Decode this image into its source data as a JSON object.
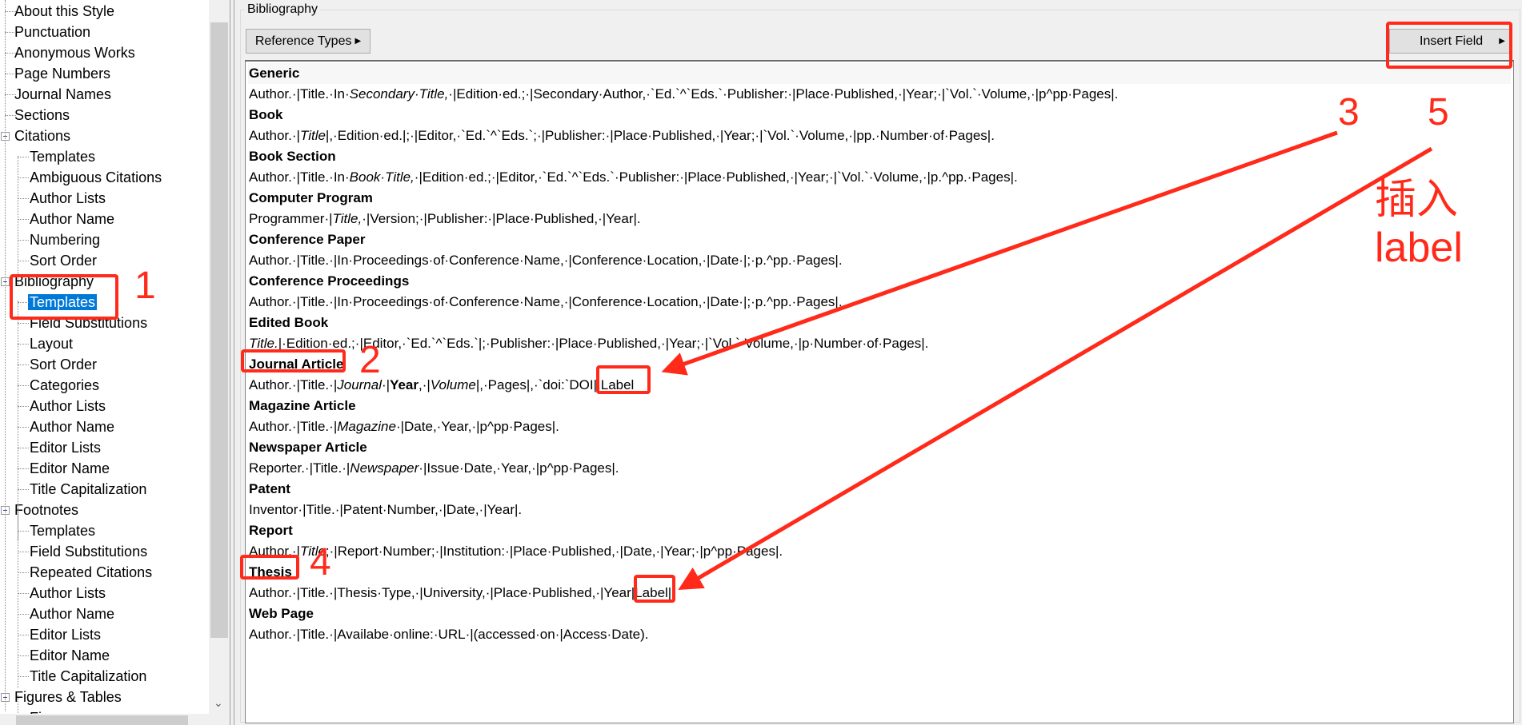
{
  "tree": {
    "items": [
      {
        "label": "About this Style",
        "level": 1
      },
      {
        "label": "Punctuation",
        "level": 1
      },
      {
        "label": "Anonymous Works",
        "level": 1
      },
      {
        "label": "Page Numbers",
        "level": 1
      },
      {
        "label": "Journal Names",
        "level": 1
      },
      {
        "label": "Sections",
        "level": 1
      },
      {
        "label": "Citations",
        "level": 0,
        "expanded": true
      },
      {
        "label": "Templates",
        "level": 2
      },
      {
        "label": "Ambiguous Citations",
        "level": 2
      },
      {
        "label": "Author Lists",
        "level": 2
      },
      {
        "label": "Author Name",
        "level": 2
      },
      {
        "label": "Numbering",
        "level": 2
      },
      {
        "label": "Sort Order",
        "level": 2
      },
      {
        "label": "Bibliography",
        "level": 0,
        "expanded": true
      },
      {
        "label": "Templates",
        "level": 2,
        "selected": true
      },
      {
        "label": "Field Substitutions",
        "level": 2
      },
      {
        "label": "Layout",
        "level": 2
      },
      {
        "label": "Sort Order",
        "level": 2
      },
      {
        "label": "Categories",
        "level": 2
      },
      {
        "label": "Author Lists",
        "level": 2
      },
      {
        "label": "Author Name",
        "level": 2
      },
      {
        "label": "Editor Lists",
        "level": 2
      },
      {
        "label": "Editor Name",
        "level": 2
      },
      {
        "label": "Title Capitalization",
        "level": 2
      },
      {
        "label": "Footnotes",
        "level": 0,
        "expanded": true
      },
      {
        "label": "Templates",
        "level": 2
      },
      {
        "label": "Field Substitutions",
        "level": 2
      },
      {
        "label": "Repeated Citations",
        "level": 2
      },
      {
        "label": "Author Lists",
        "level": 2
      },
      {
        "label": "Author Name",
        "level": 2
      },
      {
        "label": "Editor Lists",
        "level": 2
      },
      {
        "label": "Editor Name",
        "level": 2
      },
      {
        "label": "Title Capitalization",
        "level": 2
      },
      {
        "label": "Figures & Tables",
        "level": 0,
        "expanded": true
      },
      {
        "label": "Fi...",
        "level": 2
      }
    ],
    "selection_color": "#0078d7"
  },
  "panel": {
    "title": "Bibliography",
    "reference_types_label": "Reference Types",
    "insert_field_label": "Insert Field",
    "templates": [
      {
        "type": "Generic",
        "segments": [
          {
            "t": "Author.·|Title.·In·"
          },
          {
            "t": "Secondary·Title,",
            "i": true
          },
          {
            "t": "·|Edition·ed.;·|Secondary·Author,·`Ed.`^`Eds.`·Publisher:·|Place·Published,·|Year;·|`Vol.`·Volume,·|p^pp·Pages|."
          }
        ]
      },
      {
        "type": "Book",
        "segments": [
          {
            "t": "Author.·|"
          },
          {
            "t": "Title",
            "i": true
          },
          {
            "t": "|,·Edition·ed.|;·|Editor,·`Ed.`^`Eds.`;·|Publisher:·|Place·Published,·|Year;·|`Vol.`·Volume,·|pp.·Number·of·Pages|."
          }
        ]
      },
      {
        "type": "Book Section",
        "segments": [
          {
            "t": "Author.·|Title.·In·"
          },
          {
            "t": "Book·Title,",
            "i": true
          },
          {
            "t": "·|Edition·ed.;·|Editor,·`Ed.`^`Eds.`·Publisher:·|Place·Published,·|Year;·|`Vol.`·Volume,·|p.^pp.·Pages|."
          }
        ]
      },
      {
        "type": "Computer Program",
        "segments": [
          {
            "t": "Programmer·|"
          },
          {
            "t": "Title,",
            "i": true
          },
          {
            "t": "·|Version;·|Publisher:·|Place·Published,·|Year|."
          }
        ]
      },
      {
        "type": "Conference Paper",
        "segments": [
          {
            "t": "Author.·|Title.·|In·Proceedings·of·Conference·Name,·|Conference·Location,·|Date·|;·p.^pp.·Pages|."
          }
        ]
      },
      {
        "type": "Conference Proceedings",
        "segments": [
          {
            "t": "Author.·|Title.·|In·Proceedings·of·Conference·Name,·|Conference·Location,·|Date·|;·p.^pp.·Pages|."
          }
        ]
      },
      {
        "type": "Edited Book",
        "segments": [
          {
            "t": "Title.",
            "i": true
          },
          {
            "t": "|·Edition·ed.;·|Editor,·`Ed.`^`Eds.`|;·Publisher:·|Place·Published,·|Year;·|`Vol.`·Volume,·|p·Number·of·Pages|."
          }
        ]
      },
      {
        "type": "Journal Article",
        "segments": [
          {
            "t": "Author.·|Title.·|"
          },
          {
            "t": "Journal",
            "i": true
          },
          {
            "t": "·|"
          },
          {
            "t": "Year",
            "b": true
          },
          {
            "t": ",·|"
          },
          {
            "t": "Volume",
            "i": true
          },
          {
            "t": "|,·Pages|,·`doi:`DOI|.Label"
          }
        ]
      },
      {
        "type": "Magazine Article",
        "segments": [
          {
            "t": "Author.·|Title.·|"
          },
          {
            "t": "Magazine",
            "i": true
          },
          {
            "t": "·|Date,·Year,·|p^pp·Pages|."
          }
        ]
      },
      {
        "type": "Newspaper Article",
        "segments": [
          {
            "t": "Reporter.·|Title.·|"
          },
          {
            "t": "Newspaper",
            "i": true
          },
          {
            "t": "·|Issue·Date,·Year,·|p^pp·Pages|."
          }
        ]
      },
      {
        "type": "Patent",
        "segments": [
          {
            "t": "Inventor·|Title.·|Patent·Number,·|Date,·|Year|."
          }
        ]
      },
      {
        "type": "Report",
        "segments": [
          {
            "t": "Author.·|"
          },
          {
            "t": "Title",
            "i": true
          },
          {
            "t": ";·|Report·Number;·|Institution:·|Place·Published,·|Date,·|Year;·|p^pp·Pages|."
          }
        ]
      },
      {
        "type": "Thesis",
        "segments": [
          {
            "t": "Author.·|Title.·|Thesis·Type,·|University,·|Place·Published,·|Year|Label|"
          }
        ]
      },
      {
        "type": "Web Page",
        "segments": [
          {
            "t": "Author.·|Title.·|Availabe·online:·URL·|(accessed·on·|Access·Date)."
          }
        ]
      }
    ]
  },
  "annotations": {
    "color": "#ff2a1a",
    "n1": "1",
    "n2": "2",
    "n3": "3",
    "n4": "4",
    "n5": "5",
    "note_line1": "插入",
    "note_line2": "label"
  }
}
